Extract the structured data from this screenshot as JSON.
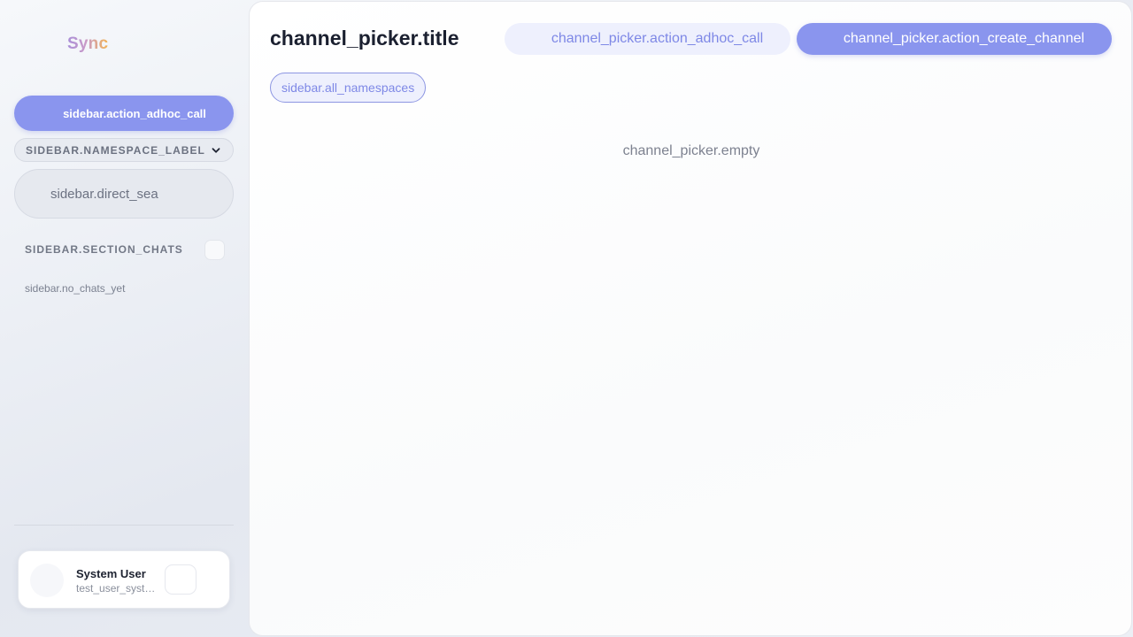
{
  "app": {
    "name": "Sync"
  },
  "sidebar": {
    "adhoc_call_label": "sidebar.action_adhoc_call",
    "namespace_label": "SIDEBAR.NAMESPACE_LABEL",
    "search_placeholder": "sidebar.direct_sea",
    "section_chats_label": "SIDEBAR.SECTION_CHATS",
    "no_chats_label": "sidebar.no_chats_yet",
    "user": {
      "name": "System User",
      "handle": "test_user_system"
    }
  },
  "main": {
    "title": "channel_picker.title",
    "action_adhoc_call_label": "channel_picker.action_adhoc_call",
    "action_create_channel_label": "channel_picker.action_create_channel",
    "all_namespaces_label": "sidebar.all_namespaces",
    "empty_label": "channel_picker.empty"
  },
  "colors": {
    "accent": "#8a95ee",
    "accent_soft": "#eef0fd",
    "logo_gradient": [
      "#a98fd8",
      "#f2b354"
    ]
  },
  "icons": {
    "namespace_dropdown": "chevron-down-icon"
  }
}
